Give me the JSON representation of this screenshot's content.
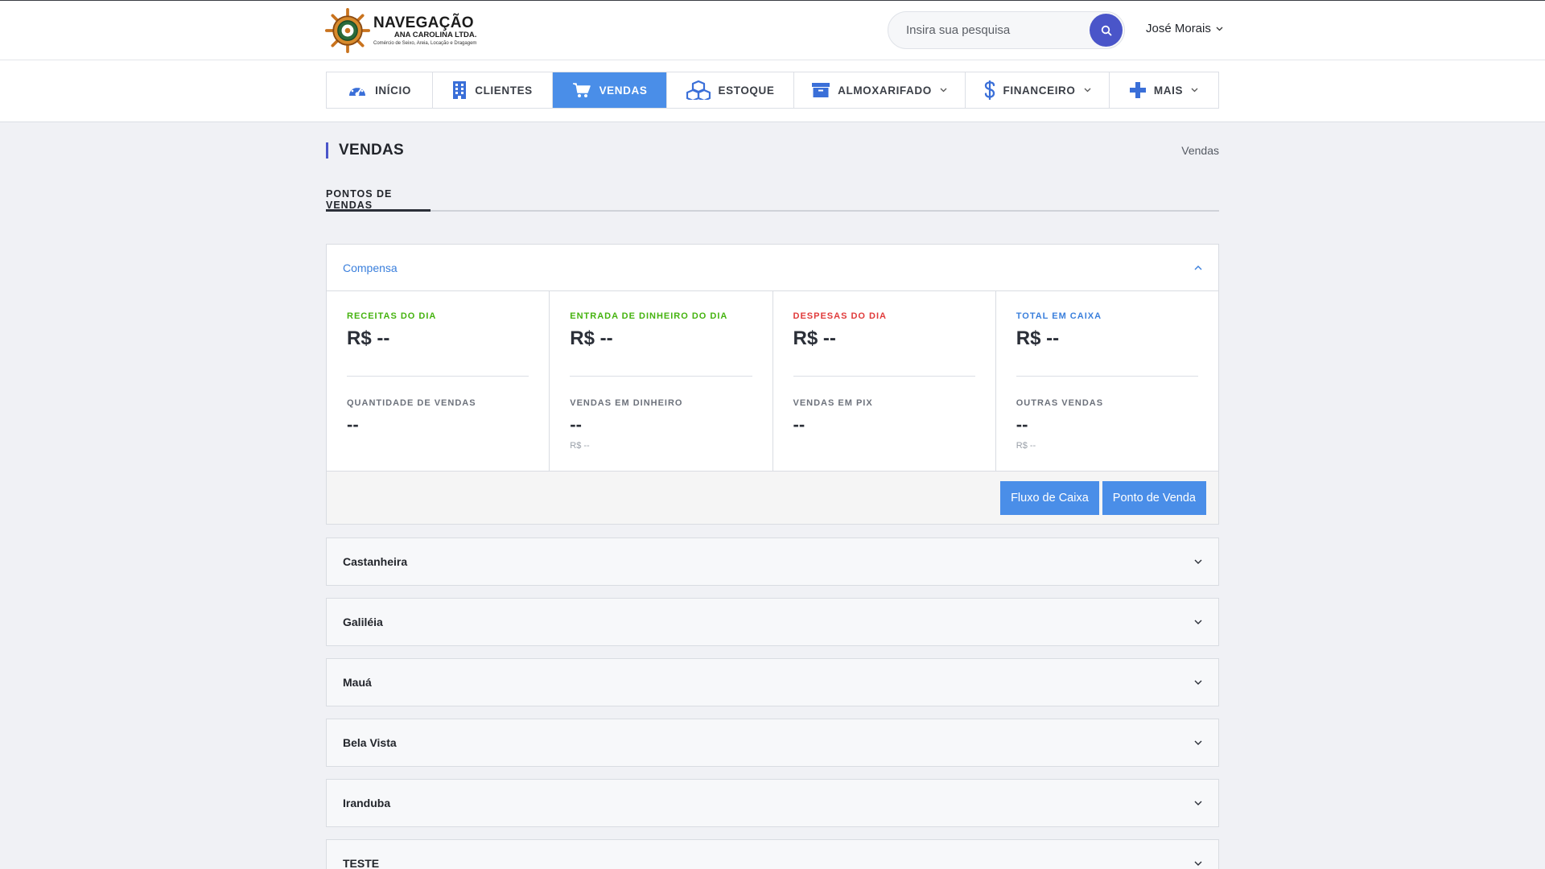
{
  "brand": {
    "title": "NAVEGAÇÃO",
    "subtitle": "ANA CAROLINA LTDA.",
    "tagline": "Comércio de Seixo, Areia, Locação e Dragagem"
  },
  "header": {
    "search_placeholder": "Insira sua pesquisa",
    "user_name": "José Morais"
  },
  "nav": {
    "items": [
      {
        "label": "INÍCIO",
        "icon": "dashboard-icon"
      },
      {
        "label": "CLIENTES",
        "icon": "building-icon"
      },
      {
        "label": "VENDAS",
        "icon": "cart-icon",
        "active": true
      },
      {
        "label": "ESTOQUE",
        "icon": "boxes-icon"
      },
      {
        "label": "ALMOXARIFADO",
        "icon": "archive-icon",
        "dropdown": true
      },
      {
        "label": "FINANCEIRO",
        "icon": "dollar-icon",
        "dropdown": true
      },
      {
        "label": "MAIS",
        "icon": "plus-icon",
        "dropdown": true
      }
    ]
  },
  "page": {
    "title": "VENDAS",
    "breadcrumb": "Vendas",
    "tab": "PONTOS DE VENDAS"
  },
  "colors": {
    "accent": "#4a8ee8",
    "primary": "#4a55c9",
    "green": "#45b30f",
    "red": "#e03a3a",
    "blue": "#3a7fdc"
  },
  "open_point": {
    "name": "Compensa",
    "stats": [
      {
        "label": "RECEITAS DO DIA",
        "value": "R$ --",
        "sub_label": "QUANTIDADE DE VENDAS",
        "sub_value": "--",
        "sub_note": ""
      },
      {
        "label": "ENTRADA DE DINHEIRO DO DIA",
        "value": "R$ --",
        "sub_label": "VENDAS EM DINHEIRO",
        "sub_value": "--",
        "sub_note": "R$ --"
      },
      {
        "label": "DESPESAS DO DIA",
        "value": "R$ --",
        "sub_label": "VENDAS EM PIX",
        "sub_value": "--",
        "sub_note": ""
      },
      {
        "label": "TOTAL EM CAIXA",
        "value": "R$ --",
        "sub_label": "OUTRAS VENDAS",
        "sub_value": "--",
        "sub_note": "R$ --"
      }
    ],
    "buttons": {
      "cash_flow": "Fluxo de Caixa",
      "pos": "Ponto de Venda"
    }
  },
  "points": [
    "Castanheira",
    "Galiléia",
    "Mauá",
    "Bela Vista",
    "Iranduba",
    "TESTE"
  ]
}
